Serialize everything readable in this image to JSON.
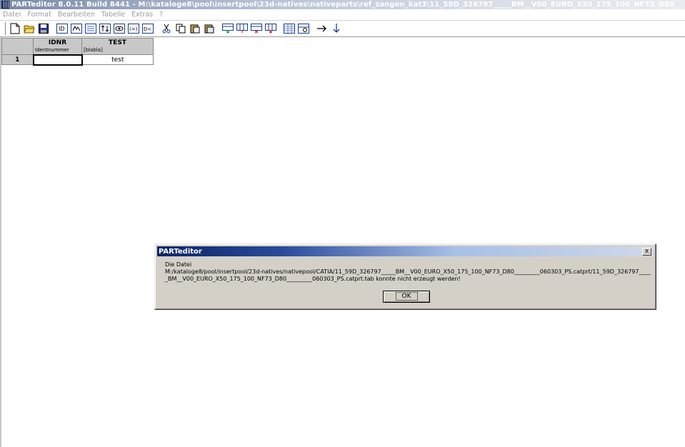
{
  "window": {
    "title": "PARTeditor 8.0.11 Build 8441 - M:\\kataloge8\\pool\\insertpool\\23d-natives\\nativeparts\\ref_zangen_kat3\\11_59D_326797_____BM__V00_EURO_X50_175_100_NF73_D80_"
  },
  "menu": {
    "items": [
      "Datei",
      "Format",
      "Bearbeiten",
      "Tabelle",
      "Extras",
      "?"
    ]
  },
  "toolbar": {
    "buttons": [
      {
        "icon": "new-file-icon"
      },
      {
        "icon": "open-folder-icon"
      },
      {
        "icon": "save-icon"
      },
      {
        "icon": "id-icon"
      },
      {
        "icon": "formula-icon"
      },
      {
        "icon": "table-edit-icon"
      },
      {
        "icon": "sort-icon"
      },
      {
        "icon": "view-icon"
      },
      {
        "icon": "variable-icon"
      },
      {
        "icon": "expand-icon"
      },
      {
        "icon": "cut-icon"
      },
      {
        "icon": "copy-icon"
      },
      {
        "icon": "paste-icon"
      },
      {
        "icon": "paste-special-icon"
      },
      {
        "icon": "insert-row-icon"
      },
      {
        "icon": "insert-column-icon"
      },
      {
        "icon": "delete-row-icon"
      },
      {
        "icon": "delete-column-icon"
      },
      {
        "icon": "grid-icon"
      },
      {
        "icon": "table-props-icon"
      },
      {
        "icon": "arrow-right-icon"
      },
      {
        "icon": "arrow-down-icon"
      }
    ]
  },
  "table": {
    "columns": [
      {
        "name": "IDNR",
        "sub": "Identnummer"
      },
      {
        "name": "TEST",
        "sub": "[blabla]"
      }
    ],
    "rows": [
      {
        "num": "1",
        "idnr": "",
        "test": "test"
      }
    ]
  },
  "dialog": {
    "title": "PARTeditor",
    "close_label": "x",
    "line1": "Die Datei",
    "line2": "M:/kataloge8/pool/insertpool/23d-natives/nativepool/CATIA/11_59D_326797_____BM__V00_EURO_X50_175_100_NF73_D80_________060303_PS.catprt/11_59D_326797_____BM__V00_EURO_X50_175_100_NF73_D80_________060303_PS.catprt.tab konnte nicht erzeugt werden!",
    "ok_label": "OK"
  }
}
